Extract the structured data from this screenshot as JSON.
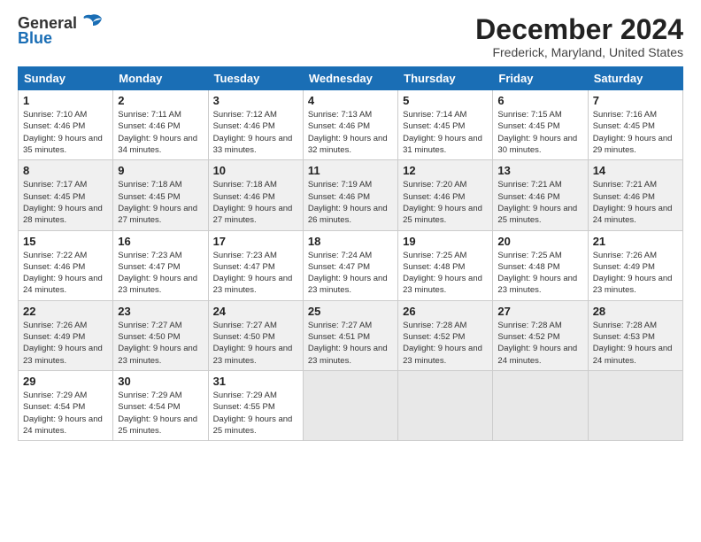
{
  "logo": {
    "general": "General",
    "blue": "Blue"
  },
  "title": "December 2024",
  "subtitle": "Frederick, Maryland, United States",
  "days_of_week": [
    "Sunday",
    "Monday",
    "Tuesday",
    "Wednesday",
    "Thursday",
    "Friday",
    "Saturday"
  ],
  "weeks": [
    [
      {
        "day": "1",
        "sunrise": "Sunrise: 7:10 AM",
        "sunset": "Sunset: 4:46 PM",
        "daylight": "Daylight: 9 hours and 35 minutes."
      },
      {
        "day": "2",
        "sunrise": "Sunrise: 7:11 AM",
        "sunset": "Sunset: 4:46 PM",
        "daylight": "Daylight: 9 hours and 34 minutes."
      },
      {
        "day": "3",
        "sunrise": "Sunrise: 7:12 AM",
        "sunset": "Sunset: 4:46 PM",
        "daylight": "Daylight: 9 hours and 33 minutes."
      },
      {
        "day": "4",
        "sunrise": "Sunrise: 7:13 AM",
        "sunset": "Sunset: 4:46 PM",
        "daylight": "Daylight: 9 hours and 32 minutes."
      },
      {
        "day": "5",
        "sunrise": "Sunrise: 7:14 AM",
        "sunset": "Sunset: 4:45 PM",
        "daylight": "Daylight: 9 hours and 31 minutes."
      },
      {
        "day": "6",
        "sunrise": "Sunrise: 7:15 AM",
        "sunset": "Sunset: 4:45 PM",
        "daylight": "Daylight: 9 hours and 30 minutes."
      },
      {
        "day": "7",
        "sunrise": "Sunrise: 7:16 AM",
        "sunset": "Sunset: 4:45 PM",
        "daylight": "Daylight: 9 hours and 29 minutes."
      }
    ],
    [
      {
        "day": "8",
        "sunrise": "Sunrise: 7:17 AM",
        "sunset": "Sunset: 4:45 PM",
        "daylight": "Daylight: 9 hours and 28 minutes."
      },
      {
        "day": "9",
        "sunrise": "Sunrise: 7:18 AM",
        "sunset": "Sunset: 4:45 PM",
        "daylight": "Daylight: 9 hours and 27 minutes."
      },
      {
        "day": "10",
        "sunrise": "Sunrise: 7:18 AM",
        "sunset": "Sunset: 4:46 PM",
        "daylight": "Daylight: 9 hours and 27 minutes."
      },
      {
        "day": "11",
        "sunrise": "Sunrise: 7:19 AM",
        "sunset": "Sunset: 4:46 PM",
        "daylight": "Daylight: 9 hours and 26 minutes."
      },
      {
        "day": "12",
        "sunrise": "Sunrise: 7:20 AM",
        "sunset": "Sunset: 4:46 PM",
        "daylight": "Daylight: 9 hours and 25 minutes."
      },
      {
        "day": "13",
        "sunrise": "Sunrise: 7:21 AM",
        "sunset": "Sunset: 4:46 PM",
        "daylight": "Daylight: 9 hours and 25 minutes."
      },
      {
        "day": "14",
        "sunrise": "Sunrise: 7:21 AM",
        "sunset": "Sunset: 4:46 PM",
        "daylight": "Daylight: 9 hours and 24 minutes."
      }
    ],
    [
      {
        "day": "15",
        "sunrise": "Sunrise: 7:22 AM",
        "sunset": "Sunset: 4:46 PM",
        "daylight": "Daylight: 9 hours and 24 minutes."
      },
      {
        "day": "16",
        "sunrise": "Sunrise: 7:23 AM",
        "sunset": "Sunset: 4:47 PM",
        "daylight": "Daylight: 9 hours and 23 minutes."
      },
      {
        "day": "17",
        "sunrise": "Sunrise: 7:23 AM",
        "sunset": "Sunset: 4:47 PM",
        "daylight": "Daylight: 9 hours and 23 minutes."
      },
      {
        "day": "18",
        "sunrise": "Sunrise: 7:24 AM",
        "sunset": "Sunset: 4:47 PM",
        "daylight": "Daylight: 9 hours and 23 minutes."
      },
      {
        "day": "19",
        "sunrise": "Sunrise: 7:25 AM",
        "sunset": "Sunset: 4:48 PM",
        "daylight": "Daylight: 9 hours and 23 minutes."
      },
      {
        "day": "20",
        "sunrise": "Sunrise: 7:25 AM",
        "sunset": "Sunset: 4:48 PM",
        "daylight": "Daylight: 9 hours and 23 minutes."
      },
      {
        "day": "21",
        "sunrise": "Sunrise: 7:26 AM",
        "sunset": "Sunset: 4:49 PM",
        "daylight": "Daylight: 9 hours and 23 minutes."
      }
    ],
    [
      {
        "day": "22",
        "sunrise": "Sunrise: 7:26 AM",
        "sunset": "Sunset: 4:49 PM",
        "daylight": "Daylight: 9 hours and 23 minutes."
      },
      {
        "day": "23",
        "sunrise": "Sunrise: 7:27 AM",
        "sunset": "Sunset: 4:50 PM",
        "daylight": "Daylight: 9 hours and 23 minutes."
      },
      {
        "day": "24",
        "sunrise": "Sunrise: 7:27 AM",
        "sunset": "Sunset: 4:50 PM",
        "daylight": "Daylight: 9 hours and 23 minutes."
      },
      {
        "day": "25",
        "sunrise": "Sunrise: 7:27 AM",
        "sunset": "Sunset: 4:51 PM",
        "daylight": "Daylight: 9 hours and 23 minutes."
      },
      {
        "day": "26",
        "sunrise": "Sunrise: 7:28 AM",
        "sunset": "Sunset: 4:52 PM",
        "daylight": "Daylight: 9 hours and 23 minutes."
      },
      {
        "day": "27",
        "sunrise": "Sunrise: 7:28 AM",
        "sunset": "Sunset: 4:52 PM",
        "daylight": "Daylight: 9 hours and 24 minutes."
      },
      {
        "day": "28",
        "sunrise": "Sunrise: 7:28 AM",
        "sunset": "Sunset: 4:53 PM",
        "daylight": "Daylight: 9 hours and 24 minutes."
      }
    ],
    [
      {
        "day": "29",
        "sunrise": "Sunrise: 7:29 AM",
        "sunset": "Sunset: 4:54 PM",
        "daylight": "Daylight: 9 hours and 24 minutes."
      },
      {
        "day": "30",
        "sunrise": "Sunrise: 7:29 AM",
        "sunset": "Sunset: 4:54 PM",
        "daylight": "Daylight: 9 hours and 25 minutes."
      },
      {
        "day": "31",
        "sunrise": "Sunrise: 7:29 AM",
        "sunset": "Sunset: 4:55 PM",
        "daylight": "Daylight: 9 hours and 25 minutes."
      },
      null,
      null,
      null,
      null
    ]
  ],
  "colors": {
    "header_bg": "#1a6eb5",
    "odd_row": "#ffffff",
    "even_row": "#f0f0f0",
    "empty_cell": "#e8e8e8"
  }
}
